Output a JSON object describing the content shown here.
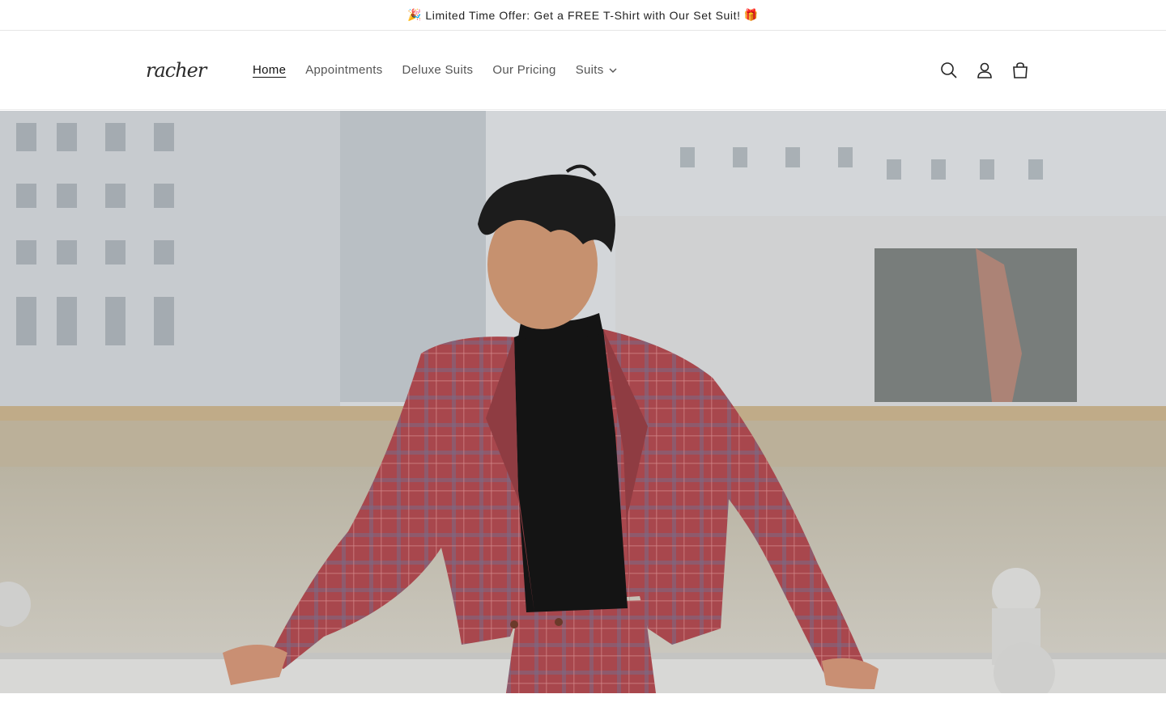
{
  "announcement": {
    "text": "Limited Time Offer: Get a FREE T-Shirt with Our Set Suit!",
    "emoji_left": "🎉",
    "emoji_right": "🎁"
  },
  "header": {
    "logo": "racher",
    "nav": [
      {
        "label": "Home",
        "active": true
      },
      {
        "label": "Appointments",
        "active": false
      },
      {
        "label": "Deluxe Suits",
        "active": false
      },
      {
        "label": "Our Pricing",
        "active": false
      },
      {
        "label": "Suits",
        "active": false,
        "dropdown": true
      }
    ],
    "icons": [
      "search-icon",
      "account-icon",
      "cart-icon"
    ]
  },
  "hero": {
    "image": "man-in-red-plaid-suit-by-river",
    "colors": {
      "suit": "#a8474d",
      "turtleneck": "#141414",
      "railing": "#d8d8d6",
      "water": "#b3ad9e"
    }
  }
}
